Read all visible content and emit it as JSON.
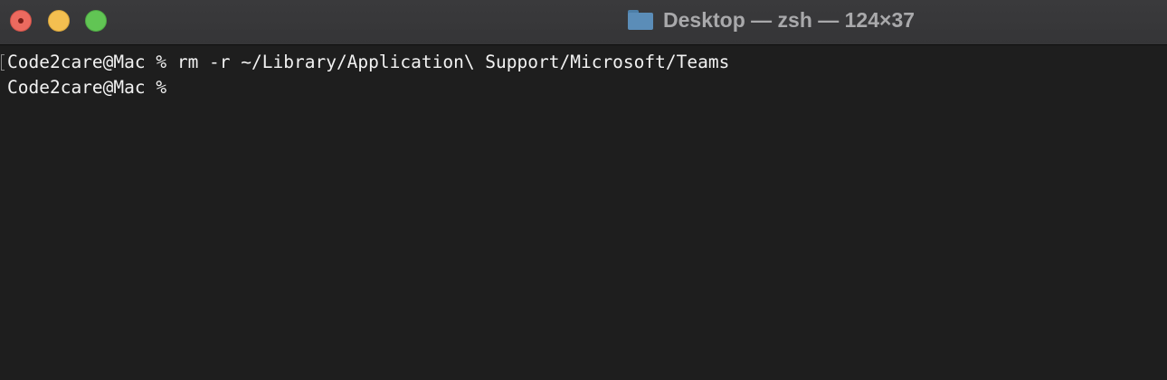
{
  "window": {
    "title": "Desktop — zsh — 124×37",
    "folder_icon": "folder-icon"
  },
  "traffic_lights": {
    "close": "#ec6a5f",
    "minimize": "#f4bf50",
    "zoom": "#61c554"
  },
  "terminal": {
    "lines": [
      "Code2care@Mac % rm -r ~/Library/Application\\ Support/Microsoft/Teams",
      "Code2care@Mac % "
    ],
    "background": "#1e1e1e",
    "foreground": "#f2f2f2"
  }
}
